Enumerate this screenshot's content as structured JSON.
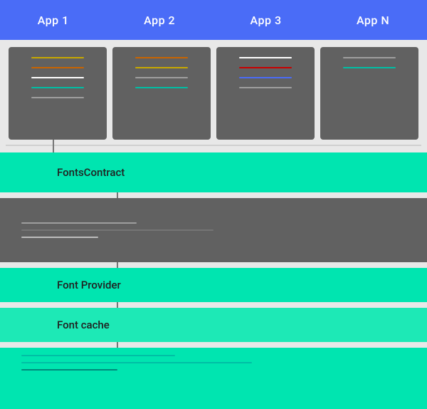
{
  "appBar": {
    "items": [
      {
        "label": "App 1"
      },
      {
        "label": "App 2"
      },
      {
        "label": "App 3"
      },
      {
        "label": "App N"
      }
    ]
  },
  "diagram": {
    "fontsContract": "FontsContract",
    "fontProvider": "Font Provider",
    "fontCache": "Font cache"
  },
  "colors": {
    "appBarBg": "#4a6cf7",
    "teal1": "#00e5b0",
    "teal2": "#1de9b6",
    "gray": "#616161"
  }
}
